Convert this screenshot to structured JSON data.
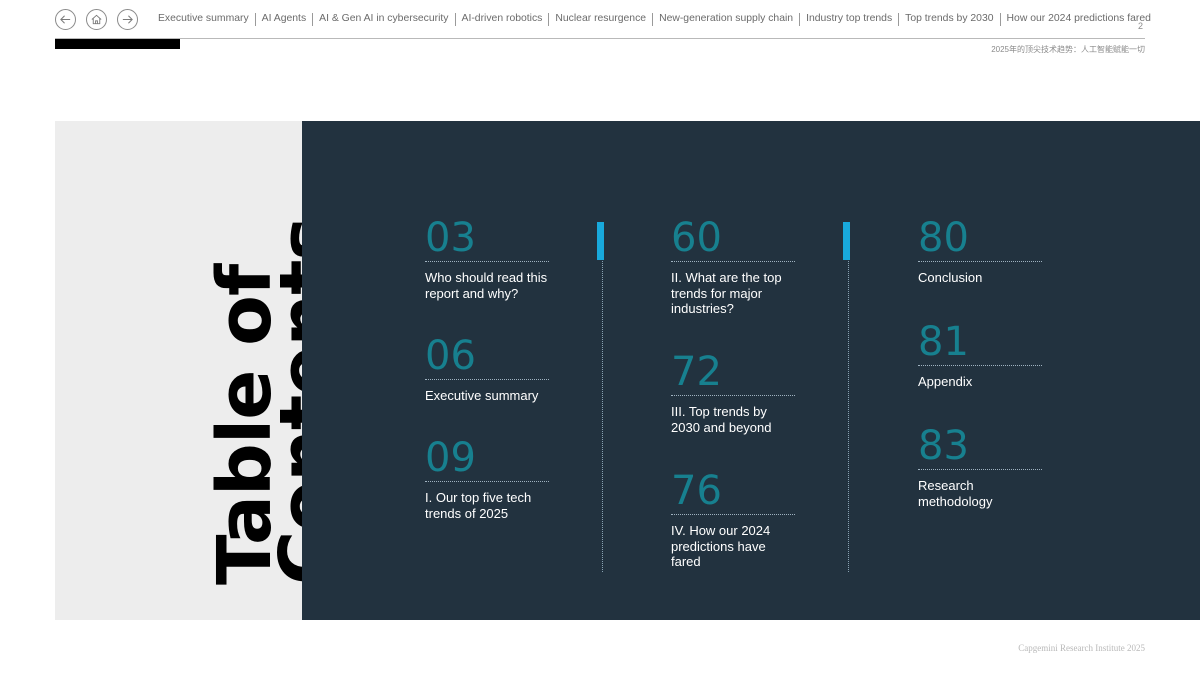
{
  "header": {
    "nav_buttons": [
      {
        "icon": "arrow-left-icon"
      },
      {
        "icon": "home-icon"
      },
      {
        "icon": "arrow-right-icon"
      }
    ],
    "nav_links": [
      "Executive summary",
      "AI Agents",
      "AI & Gen AI in cybersecurity",
      "AI-driven robotics",
      "Nuclear resurgence",
      "New-generation supply chain",
      "Industry top trends",
      "Top trends by 2030",
      "How our 2024 predictions fared"
    ],
    "page_number": "2",
    "subtitle": "2025年的顶尖技术趋势：人工智能赋能一切"
  },
  "toc": {
    "title_line1": "Table of",
    "title_line2": "Contents",
    "columns": [
      [
        {
          "page": "03",
          "label": "Who should read this report and why?"
        },
        {
          "page": "06",
          "label": "Executive summary"
        },
        {
          "page": "09",
          "label": "I. Our top five tech trends of 2025"
        }
      ],
      [
        {
          "page": "60",
          "label": "II. What are the top trends for major industries?"
        },
        {
          "page": "72",
          "label": "III. Top trends by 2030 and beyond"
        },
        {
          "page": "76",
          "label": "IV. How our 2024 predictions have fared"
        }
      ],
      [
        {
          "page": "80",
          "label": "Conclusion"
        },
        {
          "page": "81",
          "label": "Appendix"
        },
        {
          "page": "83",
          "label": "Research methodology"
        }
      ]
    ]
  },
  "footer": {
    "text": "Capgemini Research Institute 2025"
  },
  "colors": {
    "panel_dark": "#22323f",
    "panel_light": "#ededed",
    "number_teal": "#17808f",
    "accent_blue": "#18a9dc"
  }
}
